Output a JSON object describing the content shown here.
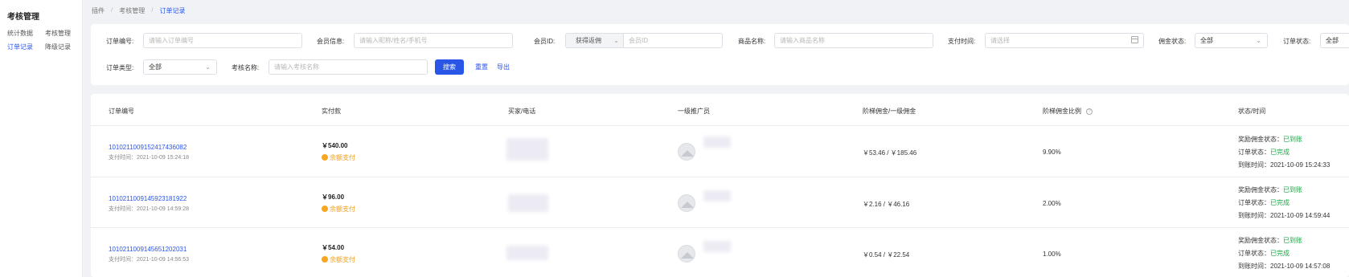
{
  "sidebar": {
    "title": "考核管理",
    "items": [
      "统计数据",
      "考核管理",
      "订单记录",
      "降级记录"
    ]
  },
  "breadcrumb": [
    "插件",
    "考核管理",
    "订单记录"
  ],
  "filters": {
    "order_no_label": "订单编号:",
    "order_no_placeholder": "请输入订单编号",
    "member_info_label": "会员信息:",
    "member_info_placeholder": "请输入昵称/姓名/手机号",
    "member_id_label": "会员ID:",
    "member_id_select": "获得返佣",
    "member_id_placeholder": "会员ID",
    "product_label": "商品名称:",
    "product_placeholder": "请输入商品名称",
    "pay_time_label": "支付时间:",
    "pay_time_placeholder": "请选择",
    "commission_status_label": "佣金状态:",
    "commission_status_value": "全部",
    "order_status_label": "订单状态:",
    "order_status_value": "全部",
    "order_type_label": "订单类型:",
    "order_type_value": "全部",
    "assess_name_label": "考核名称:",
    "assess_name_placeholder": "请输入考核名称",
    "search_button": "搜索",
    "reset_button": "重置",
    "export_button": "导出"
  },
  "table": {
    "headers": [
      "订单编号",
      "实付款",
      "买家/电话",
      "一级推广员",
      "阶梯佣金/一级佣金",
      "阶梯佣金比例",
      "状态/时间"
    ],
    "pay_time_label": "支付时间：",
    "reward_status_label": "奖励佣金状态：",
    "order_status_label": "订单状态：",
    "arrive_time_label": "到账时间：",
    "rows": [
      {
        "order_no": "101021100915241743608​2",
        "pay_time": "2021-10-09 15:24:18",
        "amount": "￥540.00",
        "pay_type": "余额支付",
        "commission": "￥53.46 / ￥185.46",
        "ratio": "9.90%",
        "reward_status": "已到账",
        "order_status": "已完成",
        "arrive_time": "2021-10-09 15:24:33"
      },
      {
        "order_no": "101021100914592318192​2",
        "pay_time": "2021-10-09 14:59:28",
        "amount": "￥96.00",
        "pay_type": "余额支付",
        "commission": "￥2.16 / ￥46.16",
        "ratio": "2.00%",
        "reward_status": "已到账",
        "order_status": "已完成",
        "arrive_time": "2021-10-09 14:59:44"
      },
      {
        "order_no": "101021100914565120203​1",
        "pay_time": "2021-10-09 14:56:53",
        "amount": "￥54.00",
        "pay_type": "余额支付",
        "commission": "￥0.54 / ￥22.54",
        "ratio": "1.00%",
        "reward_status": "已到账",
        "order_status": "已完成",
        "arrive_time": "2021-10-09 14:57:08"
      }
    ]
  },
  "colors": {
    "accent": "#2a56e8",
    "success": "#1aa845",
    "warning": "#f39c12"
  }
}
